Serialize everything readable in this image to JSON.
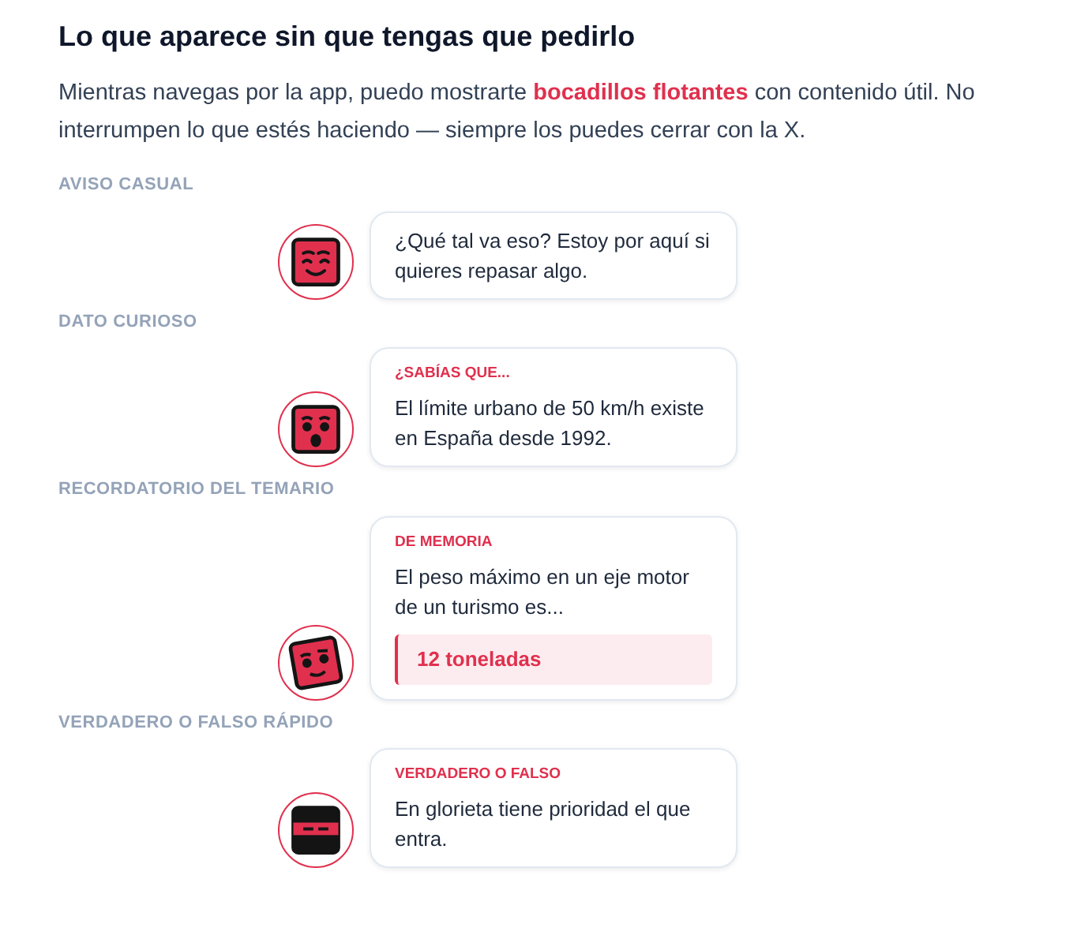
{
  "title": "Lo que aparece sin que tengas que pedirlo",
  "intro": "Mientras navegas por la app, puedo mostrarte **bocadillos flotantes** con contenido útil. No interrumpen lo que estés haciendo — siempre los puedes cerrar con la X.",
  "sections": [
    {
      "label": "AVISO CASUAL",
      "avatar": {
        "kind": "smile"
      },
      "bubble": {
        "text": "¿Qué tal va eso? Estoy por aquí si quieres repasar algo."
      }
    },
    {
      "label": "DATO CURIOSO",
      "avatar": {
        "kind": "surprised"
      },
      "bubble": {
        "tag": "¿SABÍAS QUE...",
        "text": "El límite urbano de 50 km/h existe en España desde 1992."
      }
    },
    {
      "label": "RECORDATORIO DEL TEMARIO",
      "avatar": {
        "kind": "wink"
      },
      "bubble": {
        "tag": "DE MEMORIA",
        "text": "El peso máximo en un eje motor de un turismo es...",
        "answer": "12 toneladas"
      }
    },
    {
      "label": "VERDADERO O FALSO RÁPIDO",
      "avatar": {
        "kind": "ninja"
      },
      "bubble": {
        "tag": "VERDADERO O FALSO",
        "text": "En glorieta tiene prioridad el que entra."
      }
    }
  ]
}
